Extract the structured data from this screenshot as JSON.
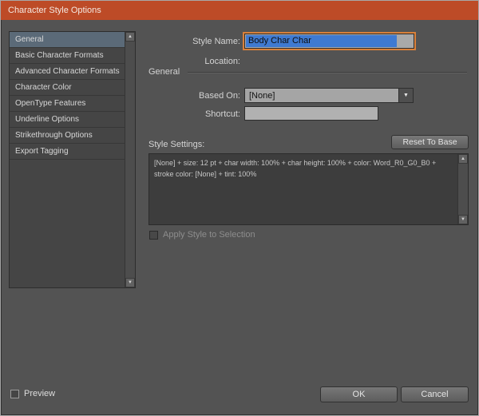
{
  "dialog": {
    "title": "Character Style Options"
  },
  "sidebar": {
    "items": [
      {
        "label": "General",
        "selected": true
      },
      {
        "label": "Basic Character Formats",
        "selected": false
      },
      {
        "label": "Advanced Character Formats",
        "selected": false
      },
      {
        "label": "Character Color",
        "selected": false
      },
      {
        "label": "OpenType Features",
        "selected": false
      },
      {
        "label": "Underline Options",
        "selected": false
      },
      {
        "label": "Strikethrough Options",
        "selected": false
      },
      {
        "label": "Export Tagging",
        "selected": false
      }
    ]
  },
  "form": {
    "style_name_label": "Style Name:",
    "style_name_value": "Body Char Char",
    "location_label": "Location:",
    "section_title": "General",
    "based_on_label": "Based On:",
    "based_on_value": "[None]",
    "shortcut_label": "Shortcut:",
    "shortcut_value": "",
    "style_settings_label": "Style Settings:",
    "reset_to_base_label": "Reset To Base",
    "style_settings_text": "[None] + size: 12 pt + char width: 100% + char height: 100% + color: Word_R0_G0_B0 + stroke color: [None] + tint: 100%",
    "apply_style_label": "Apply Style to Selection"
  },
  "footer": {
    "preview_label": "Preview",
    "ok_label": "OK",
    "cancel_label": "Cancel"
  },
  "icons": {
    "up_arrow": "▲",
    "down_arrow": "▼",
    "dropdown_arrow": "▼"
  },
  "colors": {
    "titlebar_bg": "#bd4b27",
    "dialog_bg": "#535353",
    "sidebar_selected": "#5b6a78",
    "selection_bg": "#3f7ad1",
    "focus_ring": "#d9803a"
  }
}
